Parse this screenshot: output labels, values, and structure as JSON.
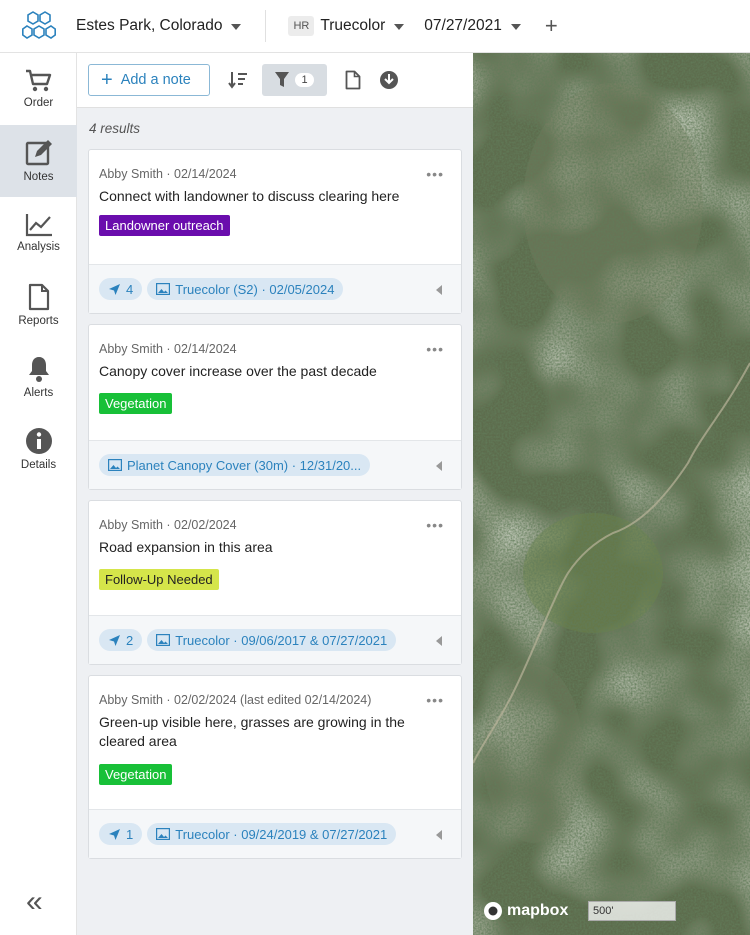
{
  "topbar": {
    "location": "Estes Park, Colorado",
    "hr_badge": "HR",
    "layer": "Truecolor",
    "date": "07/27/2021",
    "add": "+"
  },
  "sidebar": {
    "items": [
      {
        "label": "Order",
        "icon": "cart-icon"
      },
      {
        "label": "Notes",
        "icon": "note-edit-icon",
        "active": true
      },
      {
        "label": "Analysis",
        "icon": "chart-icon"
      },
      {
        "label": "Reports",
        "icon": "document-icon"
      },
      {
        "label": "Alerts",
        "icon": "bell-icon"
      },
      {
        "label": "Details",
        "icon": "info-icon"
      }
    ],
    "collapse": "«"
  },
  "toolbar": {
    "add_note": "Add a note",
    "add_plus": "+",
    "filter_count": "1"
  },
  "results": "4 results",
  "notes": [
    {
      "header": "Abby Smith · 02/14/2024",
      "text": "Connect with landowner to discuss clearing here",
      "tag": "Landowner outreach",
      "tag_color": "#6a0dad",
      "pin_count": "4",
      "imagery": "Truecolor (S2) · 02/05/2024"
    },
    {
      "header": "Abby Smith · 02/14/2024",
      "text": "Canopy cover increase over the past decade",
      "tag": "Vegetation",
      "tag_color": "#18c038",
      "imagery": "Planet Canopy Cover (30m) · 12/31/20..."
    },
    {
      "header": "Abby Smith · 02/02/2024",
      "text": "Road expansion in this area",
      "tag": "Follow-Up Needed",
      "tag_color": "#d5e54a",
      "pin_count": "2",
      "imagery": "Truecolor · 09/06/2017 & 07/27/2021"
    },
    {
      "header": "Abby Smith · 02/02/2024 (last edited 02/14/2024)",
      "text": "Green-up visible here, grasses are growing in the cleared area",
      "tag": "Vegetation",
      "tag_color": "#18c038",
      "pin_count": "1",
      "imagery": "Truecolor · 09/24/2019 & 07/27/2021"
    }
  ],
  "map": {
    "attribution": "mapbox",
    "scale": "500'"
  },
  "colors": {
    "accent": "#2b82bd",
    "active_nav": "#dde2e8",
    "panel_bg": "#eef0f3"
  }
}
